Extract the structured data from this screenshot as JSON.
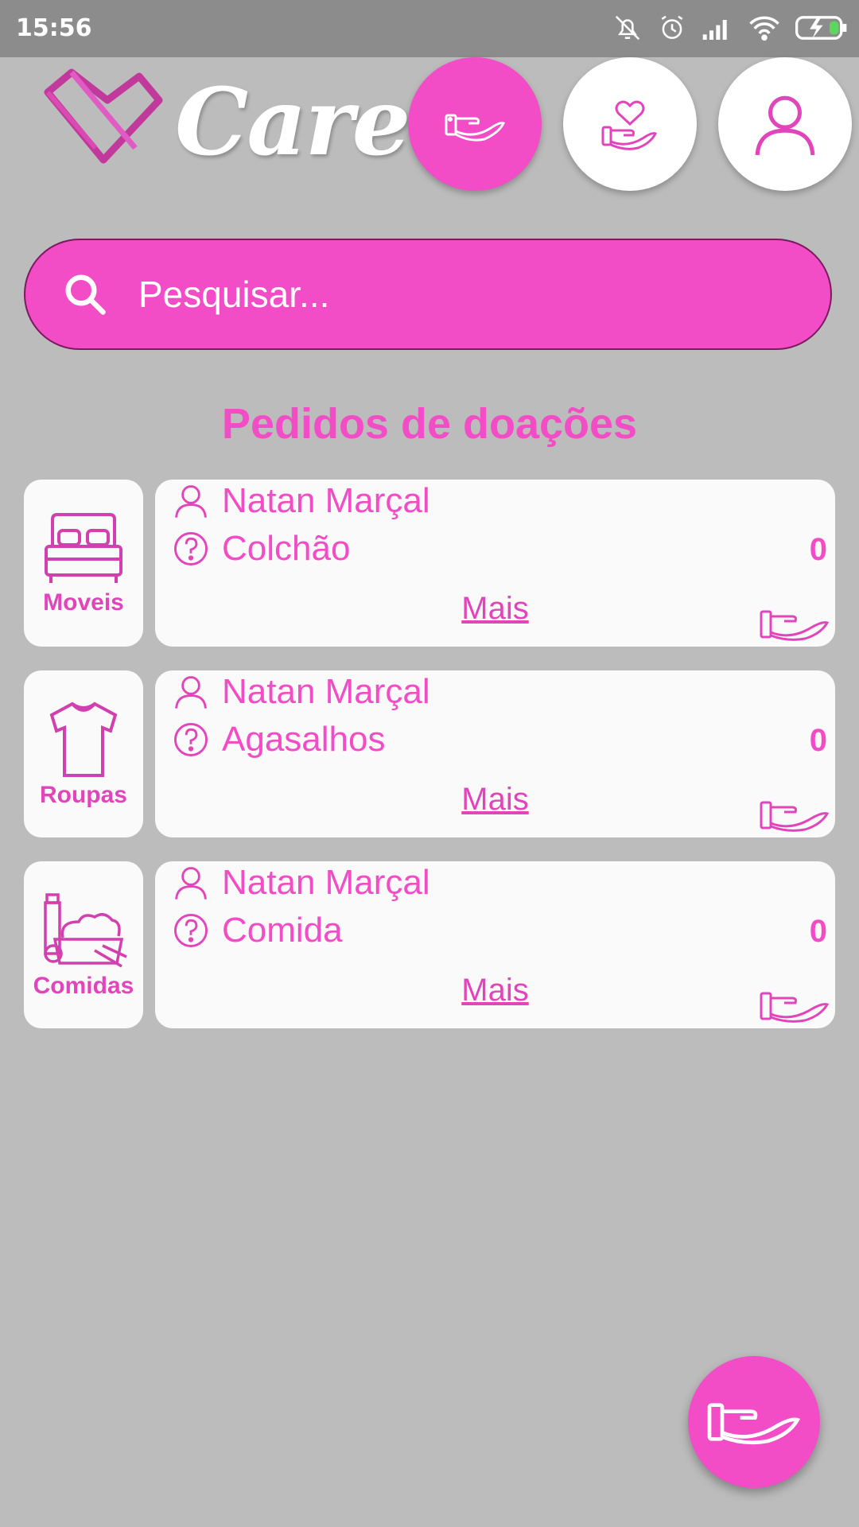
{
  "status_bar": {
    "time": "15:56",
    "icons": [
      "bell-off-icon",
      "alarm-icon",
      "signal-icon",
      "wifi-icon",
      "battery-charging-icon"
    ]
  },
  "app": {
    "title": "Care",
    "accent_color": "#f24cc6",
    "background_color": "#bcbcbc"
  },
  "top_nav": [
    {
      "name": "donate-hand",
      "icon": "open-hand-icon",
      "active": true
    },
    {
      "name": "heart-hand",
      "icon": "heart-hand-icon",
      "active": false
    },
    {
      "name": "profile",
      "icon": "user-icon",
      "active": false
    }
  ],
  "search": {
    "placeholder": "Pesquisar..."
  },
  "section": {
    "title": "Pedidos de doações"
  },
  "requests": [
    {
      "category": "Moveis",
      "category_icon": "bed-icon",
      "user": "Natan Marçal",
      "item": "Colchão",
      "count": "0",
      "more_label": "Mais"
    },
    {
      "category": "Roupas",
      "category_icon": "tshirt-icon",
      "user": "Natan Marçal",
      "item": "Agasalhos",
      "count": "0",
      "more_label": "Mais"
    },
    {
      "category": "Comidas",
      "category_icon": "groceries-icon",
      "user": "Natan Marçal",
      "item": "Comida",
      "count": "0",
      "more_label": "Mais"
    }
  ],
  "fab": {
    "icon": "open-hand-icon"
  }
}
